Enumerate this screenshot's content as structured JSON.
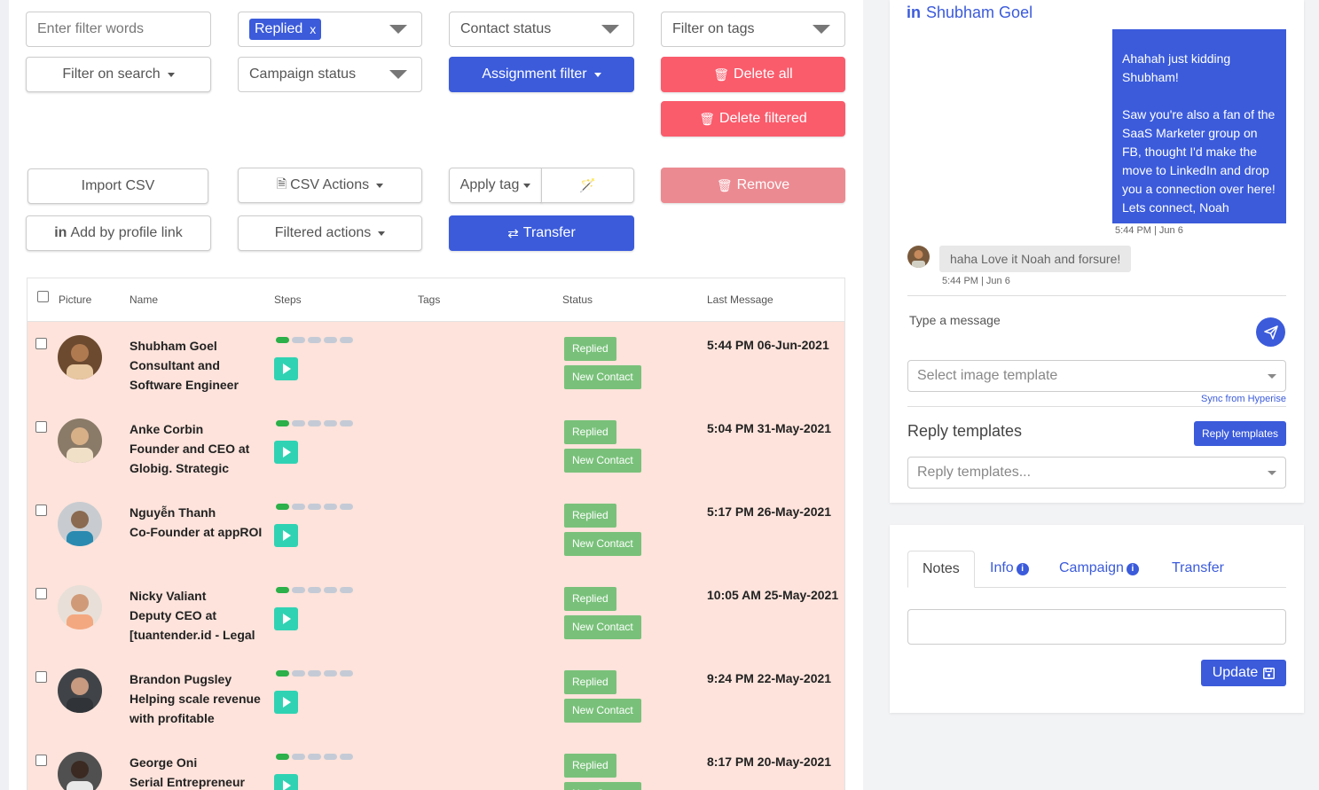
{
  "filters": {
    "filter_words_placeholder": "Enter filter words",
    "replied_chip": "Replied",
    "chip_remove": "x",
    "contact_status": "Contact status",
    "filter_on_tags": "Filter on tags",
    "filter_on_search": "Filter on search",
    "campaign_status": "Campaign status",
    "assignment_filter": "Assignment filter"
  },
  "actions": {
    "delete_all": "Delete all",
    "delete_filtered": "Delete filtered",
    "import_csv": "Import CSV",
    "csv_actions": "CSV Actions",
    "apply_tag": "Apply tag",
    "remove": "Remove",
    "add_by_profile_link": "Add by profile link",
    "filtered_actions": "Filtered actions",
    "transfer": "Transfer"
  },
  "table": {
    "headers": [
      "Picture",
      "Name",
      "Steps",
      "Tags",
      "Status",
      "Last Message"
    ],
    "rows": [
      {
        "name": "Shubham Goel\nConsultant and\nSoftware Engineer",
        "status": "Replied",
        "stage": "New Contact",
        "last_message": "5:44 PM 06-Jun-2021",
        "steps_done": 1,
        "steps_total": 5
      },
      {
        "name": "Anke Corbin\nFounder and CEO at\nGlobig. Strategic",
        "status": "Replied",
        "stage": "New Contact",
        "last_message": "5:04 PM 31-May-2021",
        "steps_done": 1,
        "steps_total": 5
      },
      {
        "name": "Nguyễn Thanh\nCo-Founder at appROI",
        "status": "Replied",
        "stage": "New Contact",
        "last_message": "5:17 PM 26-May-2021",
        "steps_done": 1,
        "steps_total": 5
      },
      {
        "name": "Nicky Valiant\nDeputy CEO at\n[tuantender.id - Legal",
        "status": "Replied",
        "stage": "New Contact",
        "last_message": "10:05 AM 25-May-2021",
        "steps_done": 1,
        "steps_total": 5
      },
      {
        "name": "Brandon Pugsley\nHelping scale revenue\nwith profitable",
        "status": "Replied",
        "stage": "New Contact",
        "last_message": "9:24 PM 22-May-2021",
        "steps_done": 1,
        "steps_total": 5
      },
      {
        "name": "George Oni\nSerial Entrepreneur",
        "status": "Replied",
        "stage": "New Contact",
        "last_message": "8:17 PM 20-May-2021",
        "steps_done": 1,
        "steps_total": 5
      }
    ]
  },
  "conversation": {
    "contact_name": "Shubham Goel",
    "outgoing_message": "Ahahah just kidding Shubham!\n\nSaw you're also a fan of the SaaS Marketer group on FB, thought I'd make the move to LinkedIn and drop you a connection over here! Lets connect, Noah",
    "outgoing_time": "5:44 PM | Jun 6",
    "incoming_message": "haha Love it Noah and forsure!",
    "incoming_time": "5:44 PM | Jun 6",
    "message_placeholder": "Type a message",
    "image_template_placeholder": "Select image template",
    "sync_link": "Sync from Hyperise",
    "reply_templates_title": "Reply templates",
    "reply_templates_button": "Reply templates",
    "reply_templates_placeholder": "Reply templates..."
  },
  "details": {
    "tabs": [
      "Notes",
      "Info",
      "Campaign",
      "Transfer"
    ],
    "update_button": "Update"
  },
  "colors": {
    "primary": "#3b5bdb",
    "danger": "#fa5c6c",
    "row_bg": "#fde3db",
    "badge": "#79c17a",
    "play": "#2fd3b3"
  }
}
